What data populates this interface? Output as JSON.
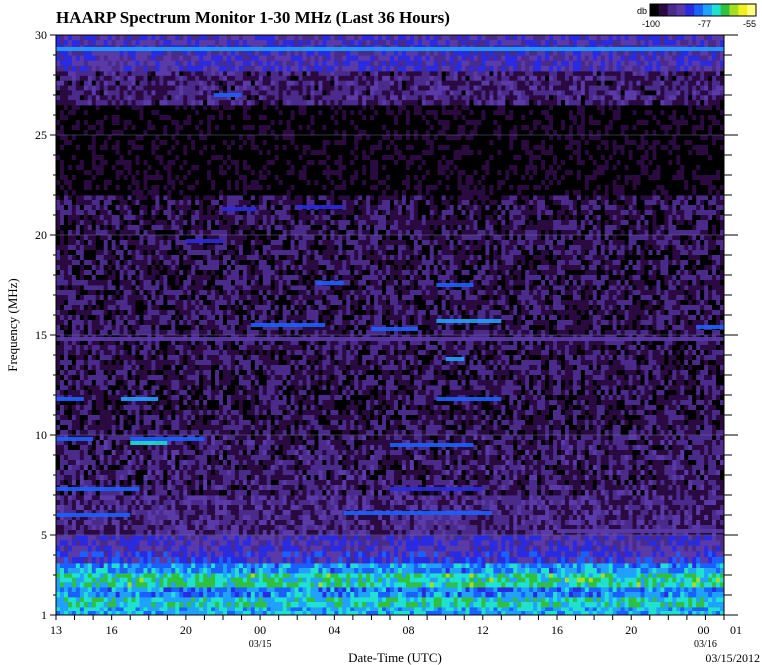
{
  "chart_data": {
    "type": "heatmap",
    "title": "HAARP Spectrum Monitor 1-30 MHz (Last 36 Hours)",
    "xlabel": "Date-Time (UTC)",
    "ylabel": "Frequency (MHz)",
    "date_stamp": "03/15/2012",
    "ylim": [
      1,
      30
    ],
    "y_ticks": [
      1,
      5,
      10,
      15,
      20,
      25,
      30
    ],
    "x_hour_span": [
      13,
      49
    ],
    "x_ticks": [
      {
        "hour": 13,
        "label": "13"
      },
      {
        "hour": 16,
        "label": "16"
      },
      {
        "hour": 20,
        "label": "20"
      },
      {
        "hour": 24,
        "label": "00",
        "date": "03/15"
      },
      {
        "hour": 28,
        "label": "04"
      },
      {
        "hour": 32,
        "label": "08"
      },
      {
        "hour": 36,
        "label": "12"
      },
      {
        "hour": 40,
        "label": "16"
      },
      {
        "hour": 44,
        "label": "20"
      },
      {
        "hour": 48,
        "label": "00",
        "date": "03/16"
      },
      {
        "hour": 49,
        "label": "01"
      }
    ],
    "colorbar": {
      "title": "db",
      "tick_labels": [
        "-100",
        "-77",
        "-55"
      ],
      "min": -100,
      "max": -55,
      "colors": [
        "#000000",
        "#2a0a40",
        "#4a2a8a",
        "#5a3aa8",
        "#2a2ae0",
        "#1a60ff",
        "#20a0ff",
        "#20e0d0",
        "#30c040",
        "#a0e020",
        "#f0f020",
        "#ffff80"
      ]
    },
    "bands": [
      {
        "f1": 1.0,
        "f2": 1.4,
        "level": 0.55
      },
      {
        "f1": 1.4,
        "f2": 1.9,
        "level": 0.62
      },
      {
        "f1": 1.9,
        "f2": 2.4,
        "level": 0.5
      },
      {
        "f1": 2.4,
        "f2": 3.1,
        "level": 0.65
      },
      {
        "f1": 3.1,
        "f2": 3.6,
        "level": 0.52
      },
      {
        "f1": 3.6,
        "f2": 4.2,
        "level": 0.35
      },
      {
        "f1": 4.2,
        "f2": 5.0,
        "level": 0.3
      },
      {
        "f1": 5.0,
        "f2": 7.0,
        "level": 0.2
      },
      {
        "f1": 7.0,
        "f2": 10.0,
        "level": 0.16
      },
      {
        "f1": 10.0,
        "f2": 12.5,
        "level": 0.13
      },
      {
        "f1": 12.5,
        "f2": 17.5,
        "level": 0.14
      },
      {
        "f1": 17.5,
        "f2": 22.0,
        "level": 0.13
      },
      {
        "f1": 22.0,
        "f2": 26.5,
        "level": 0.05
      },
      {
        "f1": 26.5,
        "f2": 28.2,
        "level": 0.18
      },
      {
        "f1": 28.2,
        "f2": 30.0,
        "level": 0.3
      }
    ],
    "signals": [
      {
        "freq": 29.3,
        "start": 13,
        "end": 49,
        "level": 0.55
      },
      {
        "freq": 27.0,
        "start": 21.5,
        "end": 23,
        "level": 0.42
      },
      {
        "freq": 21.4,
        "start": 26,
        "end": 28.5,
        "level": 0.4
      },
      {
        "freq": 21.3,
        "start": 22,
        "end": 23.8,
        "level": 0.38
      },
      {
        "freq": 19.7,
        "start": 20,
        "end": 22,
        "level": 0.4
      },
      {
        "freq": 17.6,
        "start": 27,
        "end": 28.5,
        "level": 0.45
      },
      {
        "freq": 17.5,
        "start": 33.5,
        "end": 35.5,
        "level": 0.42
      },
      {
        "freq": 15.5,
        "start": 23.5,
        "end": 27.5,
        "level": 0.45
      },
      {
        "freq": 15.3,
        "start": 30,
        "end": 32.5,
        "level": 0.42
      },
      {
        "freq": 15.7,
        "start": 33.5,
        "end": 37,
        "level": 0.5
      },
      {
        "freq": 15.4,
        "start": 47.5,
        "end": 49,
        "level": 0.42
      },
      {
        "freq": 14.8,
        "start": 13,
        "end": 49,
        "level": 0.3
      },
      {
        "freq": 13.8,
        "start": 34,
        "end": 35,
        "level": 0.55
      },
      {
        "freq": 11.8,
        "start": 13,
        "end": 14.5,
        "level": 0.42
      },
      {
        "freq": 11.8,
        "start": 16.5,
        "end": 18.5,
        "level": 0.5
      },
      {
        "freq": 11.8,
        "start": 33.5,
        "end": 37,
        "level": 0.45
      },
      {
        "freq": 9.8,
        "start": 13,
        "end": 15,
        "level": 0.42
      },
      {
        "freq": 9.8,
        "start": 17,
        "end": 21,
        "level": 0.45
      },
      {
        "freq": 9.6,
        "start": 17,
        "end": 19,
        "level": 0.6
      },
      {
        "freq": 9.5,
        "start": 31,
        "end": 35.5,
        "level": 0.48
      },
      {
        "freq": 7.3,
        "start": 13,
        "end": 17.5,
        "level": 0.42
      },
      {
        "freq": 7.3,
        "start": 31,
        "end": 36,
        "level": 0.38
      },
      {
        "freq": 6.0,
        "start": 13,
        "end": 17,
        "level": 0.45
      },
      {
        "freq": 6.1,
        "start": 28.5,
        "end": 36.5,
        "level": 0.48
      },
      {
        "freq": 5.2,
        "start": 40,
        "end": 49,
        "level": 0.32
      }
    ]
  }
}
